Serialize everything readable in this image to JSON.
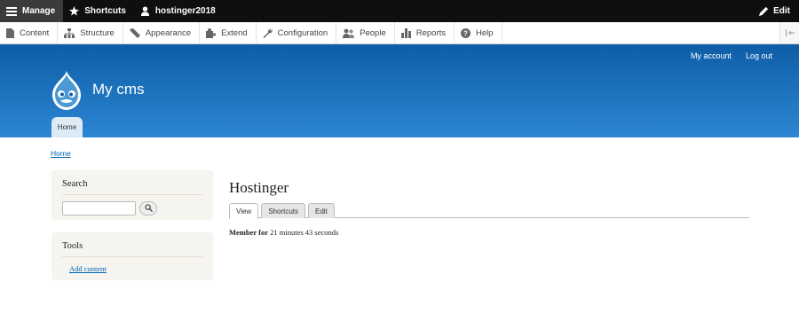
{
  "toolbar": {
    "manage_label": "Manage",
    "shortcuts_label": "Shortcuts",
    "user_label": "hostinger2018",
    "edit_label": "Edit",
    "icons": {
      "manage": "hamburger-icon",
      "shortcuts": "star-icon",
      "user": "user-icon",
      "edit": "pencil-icon"
    }
  },
  "tray": {
    "items": [
      {
        "label": "Content",
        "icon": "content-icon"
      },
      {
        "label": "Structure",
        "icon": "structure-icon"
      },
      {
        "label": "Appearance",
        "icon": "appearance-icon"
      },
      {
        "label": "Extend",
        "icon": "extend-icon"
      },
      {
        "label": "Configuration",
        "icon": "wrench-icon"
      },
      {
        "label": "People",
        "icon": "people-icon"
      },
      {
        "label": "Reports",
        "icon": "reports-icon"
      },
      {
        "label": "Help",
        "icon": "help-icon"
      }
    ]
  },
  "header": {
    "site_name": "My cms",
    "account_label": "My account",
    "logout_label": "Log out",
    "home_tab": "Home",
    "color": "#1d74c2"
  },
  "breadcrumb": {
    "home": "Home"
  },
  "sidebar": {
    "search_title": "Search",
    "search_value": "",
    "tools_title": "Tools",
    "add_content_link": "Add content"
  },
  "main": {
    "title": "Hostinger",
    "tabs": [
      {
        "label": "View",
        "active": true
      },
      {
        "label": "Shortcuts",
        "active": false
      },
      {
        "label": "Edit",
        "active": false
      }
    ],
    "member_label": "Member for",
    "member_value": "21 minutes 43 seconds"
  }
}
